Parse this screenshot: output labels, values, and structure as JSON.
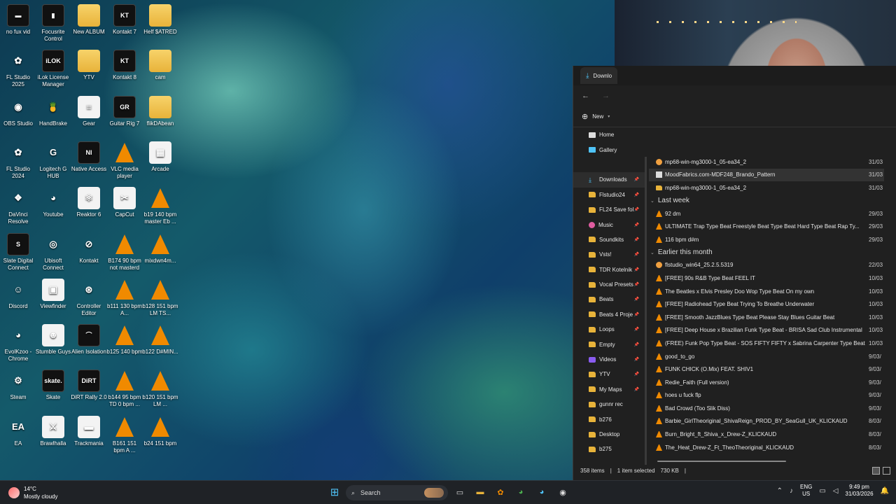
{
  "desktop_icons": [
    {
      "label": "no fux vid",
      "kind": "dark",
      "glyph": "▬",
      "col": 0,
      "row": 0
    },
    {
      "label": "Focusrite Control",
      "kind": "dark",
      "glyph": "▮",
      "col": 1,
      "row": 0
    },
    {
      "label": "New ALBUM",
      "kind": "folder",
      "glyph": "",
      "col": 2,
      "row": 0
    },
    {
      "label": "Kontakt 7",
      "kind": "dark",
      "glyph": "KT",
      "col": 3,
      "row": 0
    },
    {
      "label": "Helf $ATRED",
      "kind": "folder",
      "glyph": "",
      "col": 4,
      "row": 0
    },
    {
      "label": "FL Studio 2025",
      "kind": "round",
      "glyph": "✿",
      "col": 0,
      "row": 1
    },
    {
      "label": "iLok License Manager",
      "kind": "dark",
      "glyph": "iLOK",
      "col": 1,
      "row": 1
    },
    {
      "label": "YTV",
      "kind": "folder",
      "glyph": "",
      "col": 2,
      "row": 1
    },
    {
      "label": "Kontakt 8",
      "kind": "dark",
      "glyph": "KT",
      "col": 3,
      "row": 1
    },
    {
      "label": "cam",
      "kind": "folder",
      "glyph": "",
      "col": 4,
      "row": 1
    },
    {
      "label": "OBS Studio",
      "kind": "round",
      "glyph": "◉",
      "col": 0,
      "row": 2
    },
    {
      "label": "HandBrake",
      "kind": "round",
      "glyph": "🍍",
      "col": 1,
      "row": 2
    },
    {
      "label": "Gear",
      "kind": "doc",
      "glyph": "≡",
      "col": 2,
      "row": 2
    },
    {
      "label": "Guitar Rig 7",
      "kind": "dark",
      "glyph": "GR",
      "col": 3,
      "row": 2
    },
    {
      "label": "flikDAbean",
      "kind": "folder",
      "glyph": "",
      "col": 4,
      "row": 2
    },
    {
      "label": "FL Studio 2024",
      "kind": "round",
      "glyph": "✿",
      "col": 0,
      "row": 3
    },
    {
      "label": "Logitech G HUB",
      "kind": "round",
      "glyph": "G",
      "col": 1,
      "row": 3
    },
    {
      "label": "Native Access",
      "kind": "dark",
      "glyph": "NI",
      "col": 2,
      "row": 3
    },
    {
      "label": "VLC media player",
      "kind": "vlc",
      "glyph": "",
      "col": 3,
      "row": 3
    },
    {
      "label": "Arcade",
      "kind": "doc",
      "glyph": "▦",
      "col": 4,
      "row": 3
    },
    {
      "label": "DaVinci Resolve",
      "kind": "round",
      "glyph": "❖",
      "col": 0,
      "row": 4
    },
    {
      "label": "Youtube",
      "kind": "round",
      "glyph": "◕",
      "col": 1,
      "row": 4
    },
    {
      "label": "Reaktor 6",
      "kind": "doc",
      "glyph": "⚛",
      "col": 2,
      "row": 4
    },
    {
      "label": "CapCut",
      "kind": "doc",
      "glyph": "✂",
      "col": 3,
      "row": 4
    },
    {
      "label": "b19 140 bpm master Eb ...",
      "kind": "vlc",
      "glyph": "",
      "col": 4,
      "row": 4
    },
    {
      "label": "Slate Digital Connect",
      "kind": "dark",
      "glyph": "S",
      "col": 0,
      "row": 5
    },
    {
      "label": "Ubisoft Connect",
      "kind": "round",
      "glyph": "◎",
      "col": 1,
      "row": 5
    },
    {
      "label": "Kontakt",
      "kind": "round",
      "glyph": "⊘",
      "col": 2,
      "row": 5
    },
    {
      "label": "B174 90 bpm not masterd",
      "kind": "vlc",
      "glyph": "",
      "col": 3,
      "row": 5
    },
    {
      "label": "mixdwn4m...",
      "kind": "vlc",
      "glyph": "",
      "col": 4,
      "row": 5
    },
    {
      "label": "Discord",
      "kind": "round",
      "glyph": "☺",
      "col": 0,
      "row": 6
    },
    {
      "label": "Viewfinder",
      "kind": "doc",
      "glyph": "▣",
      "col": 1,
      "row": 6
    },
    {
      "label": "Controller Editor",
      "kind": "round",
      "glyph": "⊛",
      "col": 2,
      "row": 6
    },
    {
      "label": "b111 130 bpm A...",
      "kind": "vlc",
      "glyph": "",
      "col": 3,
      "row": 6
    },
    {
      "label": "b128 151 bpm LM TS...",
      "kind": "vlc",
      "glyph": "",
      "col": 4,
      "row": 6
    },
    {
      "label": "EvolKzoo - Chrome",
      "kind": "round",
      "glyph": "◕",
      "col": 0,
      "row": 7
    },
    {
      "label": "Stumble Guys",
      "kind": "doc",
      "glyph": "☻",
      "col": 1,
      "row": 7
    },
    {
      "label": "Alien Isolation",
      "kind": "dark",
      "glyph": "⌒",
      "col": 2,
      "row": 7
    },
    {
      "label": "b125 140 bpm",
      "kind": "vlc",
      "glyph": "",
      "col": 3,
      "row": 7
    },
    {
      "label": "b122 D#MIN...",
      "kind": "vlc",
      "glyph": "",
      "col": 4,
      "row": 7
    },
    {
      "label": "Steam",
      "kind": "round",
      "glyph": "⚙",
      "col": 0,
      "row": 8
    },
    {
      "label": "Skate",
      "kind": "dark",
      "glyph": "skate.",
      "col": 1,
      "row": 8
    },
    {
      "label": "DiRT Rally 2.0",
      "kind": "dark",
      "glyph": "DiRT",
      "col": 2,
      "row": 8
    },
    {
      "label": "b144 95 bpm TD 0 bpm ...",
      "kind": "vlc",
      "glyph": "",
      "col": 3,
      "row": 8
    },
    {
      "label": "b120 151 bpm LM ...",
      "kind": "vlc",
      "glyph": "",
      "col": 4,
      "row": 8
    },
    {
      "label": "EA",
      "kind": "round",
      "glyph": "EA",
      "col": 0,
      "row": 9
    },
    {
      "label": "Brawlhalla",
      "kind": "doc",
      "glyph": "⚔",
      "col": 1,
      "row": 9
    },
    {
      "label": "Trackmania",
      "kind": "doc",
      "glyph": "▬",
      "col": 2,
      "row": 9
    },
    {
      "label": "B161 151 bpm A ...",
      "kind": "vlc",
      "glyph": "",
      "col": 3,
      "row": 9
    },
    {
      "label": "b24 151 bpm",
      "kind": "vlc",
      "glyph": "",
      "col": 4,
      "row": 9
    }
  ],
  "explorer": {
    "tab_label": "Downlo",
    "toolbar": {
      "new_label": "New"
    },
    "sidebar": [
      {
        "label": "Home",
        "icon": "home",
        "pinned": false,
        "active": false
      },
      {
        "label": "Gallery",
        "icon": "gal",
        "pinned": false,
        "active": false
      },
      {
        "label": "",
        "icon": "",
        "pinned": false,
        "active": false
      },
      {
        "label": "Downloads",
        "icon": "dl",
        "pinned": true,
        "active": true
      },
      {
        "label": "Flstudio24",
        "icon": "folder",
        "pinned": true,
        "active": false
      },
      {
        "label": "FL24 Save fol",
        "icon": "folder",
        "pinned": true,
        "active": false
      },
      {
        "label": "Music",
        "icon": "music",
        "pinned": true,
        "active": false
      },
      {
        "label": "Soundkits",
        "icon": "folder",
        "pinned": true,
        "active": false
      },
      {
        "label": "Vsts!",
        "icon": "folder",
        "pinned": true,
        "active": false
      },
      {
        "label": "TDR Kotelnik",
        "icon": "folder",
        "pinned": true,
        "active": false
      },
      {
        "label": "Vocal Presets",
        "icon": "folder",
        "pinned": true,
        "active": false
      },
      {
        "label": "Beats",
        "icon": "folder",
        "pinned": true,
        "active": false
      },
      {
        "label": "Beats 4 Proje",
        "icon": "folder",
        "pinned": true,
        "active": false
      },
      {
        "label": "Loops",
        "icon": "folder",
        "pinned": true,
        "active": false
      },
      {
        "label": "Empty",
        "icon": "folder",
        "pinned": true,
        "active": false
      },
      {
        "label": "Videos",
        "icon": "video",
        "pinned": true,
        "active": false
      },
      {
        "label": "YTV",
        "icon": "folder",
        "pinned": true,
        "active": false
      },
      {
        "label": "My Maps",
        "icon": "folder",
        "pinned": true,
        "active": false
      },
      {
        "label": "gunnr rec",
        "icon": "folder",
        "pinned": false,
        "active": false
      },
      {
        "label": "b276",
        "icon": "folder",
        "pinned": false,
        "active": false
      },
      {
        "label": "Desktop",
        "icon": "folder",
        "pinned": false,
        "active": false
      },
      {
        "label": "b275",
        "icon": "folder",
        "pinned": false,
        "active": false
      }
    ],
    "files": [
      {
        "type": "row",
        "name": "mp68-win-mg3000-1_05-ea34_2",
        "date": "31/03",
        "icon": "exe",
        "selected": false
      },
      {
        "type": "row",
        "name": "MoodFabrics.com-MDF248_Brando_Pattern",
        "date": "31/03",
        "icon": "file",
        "selected": true
      },
      {
        "type": "row",
        "name": "mp68-win-mg3000-1_05-ea34_2",
        "date": "31/03",
        "icon": "folder",
        "selected": false
      },
      {
        "type": "group",
        "name": "Last week"
      },
      {
        "type": "row",
        "name": "92 dm",
        "date": "29/03",
        "icon": "mp3",
        "selected": false
      },
      {
        "type": "row",
        "name": "ULTIMATE  Trap Type Beat  Freestyle Beat  Type Beat  Hard Type Beat  Rap Ty...",
        "date": "29/03",
        "icon": "mp3",
        "selected": false
      },
      {
        "type": "row",
        "name": "116 bpm d#m",
        "date": "29/03",
        "icon": "mp3",
        "selected": false
      },
      {
        "type": "group",
        "name": "Earlier this month"
      },
      {
        "type": "row",
        "name": "flstudio_win64_25.2.5.5319",
        "date": "22/03",
        "icon": "exe",
        "selected": false
      },
      {
        "type": "row",
        "name": "[FREE] 90s R&B Type Beat FEEL IT",
        "date": "10/03",
        "icon": "mp3",
        "selected": false
      },
      {
        "type": "row",
        "name": "The Beatles x Elvis Presley Doo Wop Type Beat  On my own",
        "date": "10/03",
        "icon": "mp3",
        "selected": false
      },
      {
        "type": "row",
        "name": "[FREE] Radiohead Type Beat  Trying To Breathe Underwater",
        "date": "10/03",
        "icon": "mp3",
        "selected": false
      },
      {
        "type": "row",
        "name": "[FREE] Smooth JazzBlues Type Beat  Please Stay  Blues Guitar Beat",
        "date": "10/03",
        "icon": "mp3",
        "selected": false
      },
      {
        "type": "row",
        "name": "[FREE] Deep House x Brazilian Funk Type Beat - BRISA  Sad Club Instrumental",
        "date": "10/03",
        "icon": "mp3",
        "selected": false
      },
      {
        "type": "row",
        "name": "(FREE) Funk Pop Type Beat - SOS  FIFTY FIFTY x Sabrina Carpenter Type Beat",
        "date": "10/03",
        "icon": "mp3",
        "selected": false
      },
      {
        "type": "row",
        "name": "good_to_go",
        "date": "9/03/",
        "icon": "mp3",
        "selected": false
      },
      {
        "type": "row",
        "name": "FUNK CHICK (O.Mix) FEAT. SHIV1",
        "date": "9/03/",
        "icon": "mp3",
        "selected": false
      },
      {
        "type": "row",
        "name": "Redie_Faith (Full version)",
        "date": "9/03/",
        "icon": "mp3",
        "selected": false
      },
      {
        "type": "row",
        "name": "hoes u fuck flp",
        "date": "9/03/",
        "icon": "mp3",
        "selected": false
      },
      {
        "type": "row",
        "name": "Bad Crowd (Too Slik Diss)",
        "date": "9/03/",
        "icon": "mp3",
        "selected": false
      },
      {
        "type": "row",
        "name": "Barbie_GirlTheoriginal_ShivaReign_PROD_BY_SeaGull_UK_KLICKAUD",
        "date": "8/03/",
        "icon": "mp3",
        "selected": false
      },
      {
        "type": "row",
        "name": "Burn_Bright_ft_Shiva_x_Drew-Z_KLICKAUD",
        "date": "8/03/",
        "icon": "mp3",
        "selected": false
      },
      {
        "type": "row",
        "name": "The_Heat_Drew-Z_Ft_TheoTheoriginal_KLICKAUD",
        "date": "8/03/",
        "icon": "mp3",
        "selected": false
      }
    ],
    "status": {
      "items": "358 items",
      "selected": "1 item selected",
      "size": "730 KB"
    }
  },
  "taskbar": {
    "weather_temp": "14°C",
    "weather_desc": "Mostly cloudy",
    "search_label": "Search",
    "lang_line1": "ENG",
    "lang_line2": "US",
    "time": "9:49 pm",
    "date": "31/03/2026"
  },
  "colors": {
    "accent": "#4fc3f7",
    "vlc_orange": "#f08a00",
    "folder": "#e8b33a",
    "taskbar": "#1f2226"
  }
}
